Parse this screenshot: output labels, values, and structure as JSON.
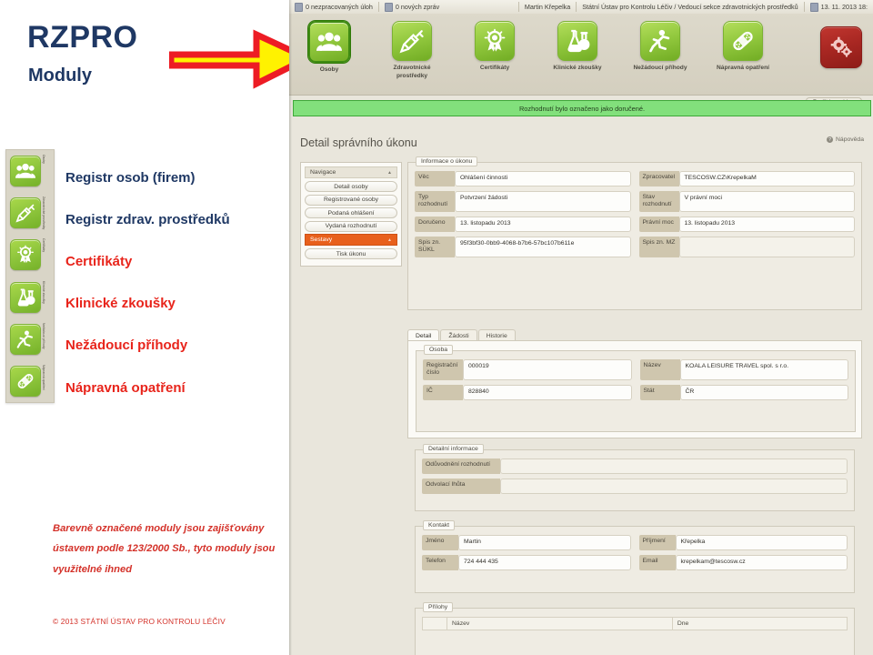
{
  "slide": {
    "title": "RZPRO",
    "subtitle": "Moduly",
    "note": "Barevně označené moduly jsou zajišťovány ústavem podle 123/2000 Sb., tyto moduly jsou využitelné ihned",
    "copyright": "© 2013  STÁTNÍ ÚSTAV PRO KONTROLU LÉČIV",
    "accent_blue": "#1F3864",
    "accent_red": "#E8241B",
    "modules": [
      {
        "label": "Registr osob (firem)",
        "color": "blue",
        "icon": "people-icon",
        "rail_label": "Osoby"
      },
      {
        "label": "Registr zdrav. prostředků",
        "color": "blue",
        "icon": "syringe-icon",
        "rail_label": "Zdravotnické prostředky"
      },
      {
        "label": "Certifikáty",
        "color": "red",
        "icon": "rosette-icon",
        "rail_label": "Certifikáty"
      },
      {
        "label": "Klinické zkoušky",
        "color": "red",
        "icon": "flask-icon",
        "rail_label": "Klinické zkoušky"
      },
      {
        "label": "Nežádoucí příhody",
        "color": "red",
        "icon": "falling-person-icon",
        "rail_label": "Nežádoucí příhody"
      },
      {
        "label": "Nápravná opatření",
        "color": "red",
        "icon": "bandage-icon",
        "rail_label": "Nápravná opatření"
      }
    ]
  },
  "app": {
    "statusbar": {
      "tasks": "0 nezpracovaných úloh",
      "messages": "0 nových zpráv",
      "user": "Martin Křepelka",
      "role": "Státní Ústav pro Kontrolu Léčiv / Vedoucí sekce zdravotnických prostředků",
      "datetime": "13. 11. 2013 18:"
    },
    "launchbar": {
      "items": [
        {
          "label": "Osoby",
          "icon": "people-icon",
          "selected": true
        },
        {
          "label": "Zdravotnické prostředky",
          "icon": "syringe-icon",
          "selected": false
        },
        {
          "label": "Certifikáty",
          "icon": "rosette-icon",
          "selected": false
        },
        {
          "label": "Klinické zkoušky",
          "icon": "flask-icon",
          "selected": false
        },
        {
          "label": "Nežádoucí příhody",
          "icon": "falling-person-icon",
          "selected": false
        },
        {
          "label": "Nápravná opatření",
          "icon": "bandage-icon",
          "selected": false
        }
      ],
      "admin_icon": "gears-icon",
      "close_label": "Zavřít launchbar"
    },
    "flash_message": "Rozhodnutí bylo označeno jako doručené.",
    "page_title": "Detail správního úkonu",
    "help_label": "Nápověda",
    "navigation": {
      "header": "Navigace",
      "items": [
        "Detail osoby",
        "Registrované osoby",
        "Podaná ohlášení",
        "Vydaná rozhodnutí"
      ],
      "section_header": "Sestavy",
      "section_items": [
        "Tisk úkonu"
      ],
      "section_color": "#E8601C"
    },
    "info_section": {
      "legend": "Informace o úkonu",
      "fields": [
        {
          "label": "Věc",
          "value": "Ohlášení činnosti"
        },
        {
          "label": "Zpracovatel",
          "value": "TESCOSW.CZ\\KrepelkaM"
        },
        {
          "label": "Typ rozhodnutí",
          "value": "Potvrzení žádosti"
        },
        {
          "label": "Stav rozhodnutí",
          "value": "V právní moci"
        },
        {
          "label": "Doručeno",
          "value": "13. listopadu 2013"
        },
        {
          "label": "Právní moc",
          "value": "13. listopadu 2013"
        },
        {
          "label": "Spis zn. SÚKL",
          "value": "95f3bf30-0bb9-4068-b7b6-57bc107b611e"
        },
        {
          "label": "Spis zn. MZ",
          "value": ""
        }
      ]
    },
    "tabs": [
      {
        "label": "Detail",
        "active": true
      },
      {
        "label": "Žádosti",
        "active": false
      },
      {
        "label": "Historie",
        "active": false
      }
    ],
    "osoba_section": {
      "legend": "Osoba",
      "fields": [
        {
          "label": "Registrační číslo",
          "value": "000019"
        },
        {
          "label": "Název",
          "value": "KOALA LEISURE TRAVEL spol. s r.o."
        },
        {
          "label": "IČ",
          "value": "828840"
        },
        {
          "label": "Stát",
          "value": "ČR"
        }
      ]
    },
    "detail_section": {
      "legend": "Detailní informace",
      "fields": [
        {
          "label": "Odůvodnění rozhodnutí",
          "value": ""
        },
        {
          "label": "Odvolací lhůta",
          "value": ""
        }
      ]
    },
    "kontakt_section": {
      "legend": "Kontakt",
      "fields": [
        {
          "label": "Jméno",
          "value": "Martin"
        },
        {
          "label": "Příjmení",
          "value": "Křepelka"
        },
        {
          "label": "Telefon",
          "value": "724 444 435"
        },
        {
          "label": "Email",
          "value": "krepelkam@tescosw.cz"
        }
      ]
    },
    "prilohy_section": {
      "legend": "Přílohy",
      "columns": [
        "",
        "Název",
        "Dne"
      ]
    }
  },
  "annotation": {
    "arrow_fill": "#FFF200",
    "arrow_stroke": "#ED1C24",
    "points_to": "Osoby"
  }
}
